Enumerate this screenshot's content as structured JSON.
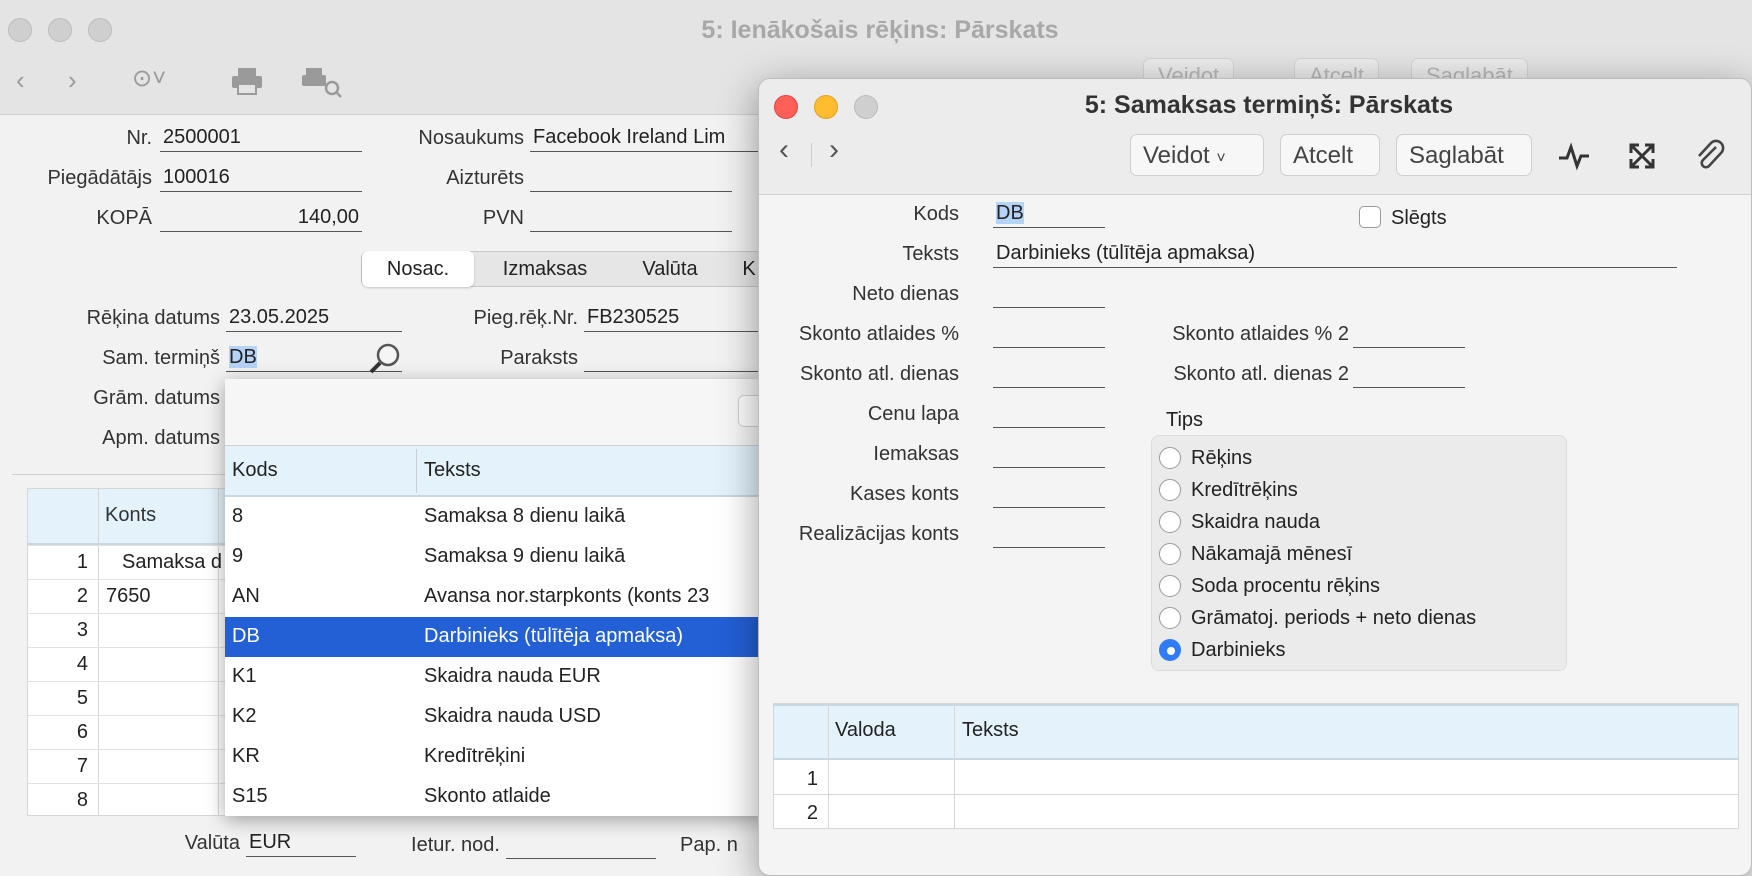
{
  "main_window": {
    "title": "5: Ienākošais rēķins: Pārskats",
    "toolbar": {
      "create_label": "Veidot",
      "cancel_label": "Atcelt",
      "save_label": "Saglabāt"
    },
    "header": {
      "nr_label": "Nr.",
      "nr_value": "2500001",
      "supplier_label": "Piegādātājs",
      "supplier_value": "100016",
      "total_label": "KOPĀ",
      "total_value": "140,00",
      "name_label": "Nosaukums",
      "name_value": "Facebook Ireland Lim",
      "held_label": "Aizturēts",
      "held_value": "",
      "vat_label": "PVN",
      "vat_value": ""
    },
    "tabs": [
      "Nosac.",
      "Izmaksas",
      "Valūta",
      "K"
    ],
    "terms": {
      "invoice_date_label": "Rēķina datums",
      "invoice_date_value": "23.05.2025",
      "supplier_inv_label": "Pieg.rēķ.Nr.",
      "supplier_inv_value": "FB230525",
      "pay_terms_label": "Sam. termiņš",
      "pay_terms_value": "DB",
      "signature_label": "Paraksts",
      "signature_value": "",
      "posting_date_label": "Grām. datums",
      "pay_date_label": "Apm. datums"
    },
    "grid": {
      "col_account": "Konts",
      "rows": [
        {
          "n": "1",
          "account": "Samaksa d"
        },
        {
          "n": "2",
          "account": "7650"
        },
        {
          "n": "3",
          "account": ""
        },
        {
          "n": "4",
          "account": ""
        },
        {
          "n": "5",
          "account": ""
        },
        {
          "n": "6",
          "account": ""
        },
        {
          "n": "7",
          "account": ""
        },
        {
          "n": "8",
          "account": ""
        }
      ]
    },
    "footer": {
      "currency_label": "Valūta",
      "currency_value": "EUR",
      "dept_label": "Ietur. nod.",
      "pap_label": "Pap. n"
    }
  },
  "popup": {
    "col_code": "Kods",
    "col_text": "Teksts",
    "rows": [
      {
        "code": "8",
        "text": "Samaksa 8 dienu laikā"
      },
      {
        "code": "9",
        "text": "Samaksa 9 dienu laikā"
      },
      {
        "code": "AN",
        "text": "Avansa nor.starpkonts (konts 23"
      },
      {
        "code": "DB",
        "text": "Darbinieks (tūlītēja apmaksa)"
      },
      {
        "code": "K1",
        "text": "Skaidra nauda EUR"
      },
      {
        "code": "K2",
        "text": "Skaidra nauda USD"
      },
      {
        "code": "KR",
        "text": "Kredītrēķini"
      },
      {
        "code": "S15",
        "text": "Skonto atlaide"
      }
    ],
    "selected_code": "DB"
  },
  "terms_window": {
    "title": "5: Samaksas termiņš: Pārskats",
    "create_label": "Veidot",
    "cancel_label": "Atcelt",
    "save_label": "Saglabāt",
    "code_label": "Kods",
    "code_value": "DB",
    "closed_label": "Slēgts",
    "text_label": "Teksts",
    "text_value": "Darbinieks (tūlītēja apmaksa)",
    "net_days_label": "Neto dienas",
    "disc_pct_label": "Skonto atlaides %",
    "disc_days_label": "Skonto atl. dienas",
    "disc_pct2_label": "Skonto atlaides % 2",
    "disc_days2_label": "Skonto atl. dienas 2",
    "price_list_label": "Cenu lapa",
    "payments_label": "Iemaksas",
    "cash_account_label": "Kases konts",
    "realization_label": "Realizācijas konts",
    "type_label": "Tips",
    "types": [
      "Rēķins",
      "Kredītrēķins",
      "Skaidra nauda",
      "Nākamajā mēnesī",
      "Soda procentu rēķins",
      "Grāmatoj. periods + neto dienas",
      "Darbinieks"
    ],
    "selected_type": "Darbinieks",
    "lang_grid": {
      "col_lang": "Valoda",
      "col_text": "Teksts",
      "rows": [
        "1",
        "2"
      ]
    }
  }
}
